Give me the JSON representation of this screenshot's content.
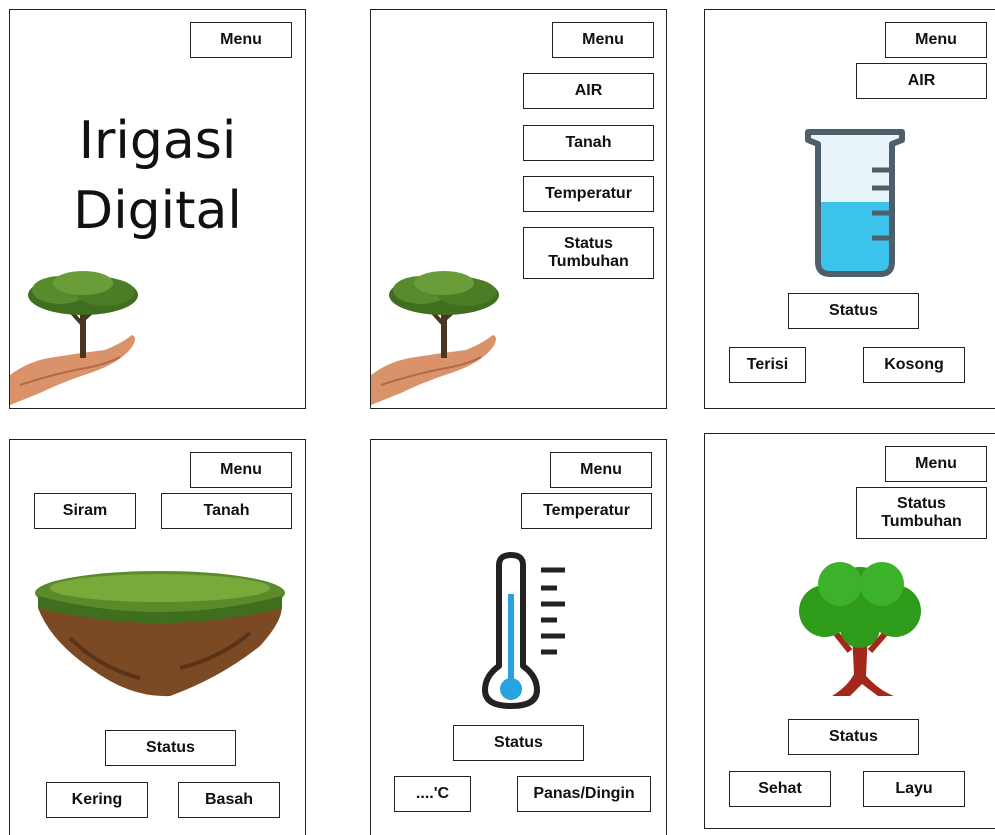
{
  "panels": {
    "home": {
      "menu": "Menu",
      "title_line1": "Irigasi",
      "title_line2": "Digital"
    },
    "menu": {
      "menu": "Menu",
      "items": [
        "AIR",
        "Tanah",
        "Temperatur",
        "Status\nTumbuhan"
      ]
    },
    "air": {
      "menu": "Menu",
      "header": "AIR",
      "status": "Status",
      "option_a": "Terisi",
      "option_b": "Kosong"
    },
    "tanah": {
      "menu": "Menu",
      "siram": "Siram",
      "header": "Tanah",
      "status": "Status",
      "option_a": "Kering",
      "option_b": "Basah"
    },
    "temperatur": {
      "menu": "Menu",
      "header": "Temperatur",
      "status": "Status",
      "option_a": "....'C",
      "option_b": "Panas/Dingin"
    },
    "tumbuhan": {
      "menu": "Menu",
      "header": "Status\nTumbuhan",
      "status": "Status",
      "option_a": "Sehat",
      "option_b": "Layu"
    }
  },
  "icons": [
    "tree-in-hand-icon",
    "beaker-icon",
    "soil-island-icon",
    "thermometer-icon",
    "tree-icon"
  ],
  "colors": {
    "water": "#3cc3ec",
    "thermo_blue": "#29a3e0",
    "leaf_green": "#2e9b1a",
    "trunk_red": "#a4271c",
    "soil_brown": "#7b4a25",
    "grass_green": "#5a8a2a"
  }
}
